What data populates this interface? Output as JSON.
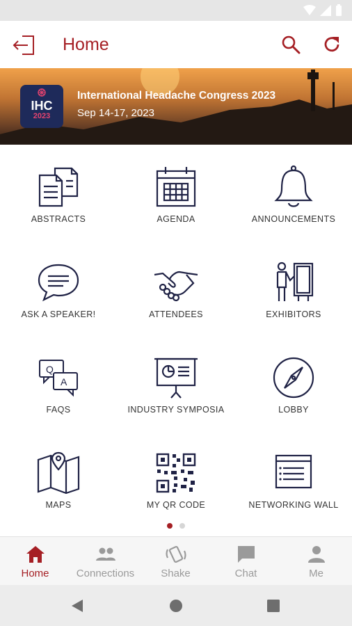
{
  "colors": {
    "accent": "#a51f24",
    "icon": "#1f2245",
    "inactive": "#9a9a9a"
  },
  "header": {
    "title": "Home"
  },
  "banner": {
    "logo_main": "IHC",
    "logo_year": "2023",
    "event_name": "International Headache Congress 2023",
    "dates": "Sep 14-17, 2023"
  },
  "tiles": [
    {
      "label": "ABSTRACTS",
      "icon": "documents-icon"
    },
    {
      "label": "AGENDA",
      "icon": "calendar-icon"
    },
    {
      "label": "ANNOUNCEMENTS",
      "icon": "bell-icon"
    },
    {
      "label": "ASK A SPEAKER!",
      "icon": "speech-bubble-icon"
    },
    {
      "label": "ATTENDEES",
      "icon": "handshake-icon"
    },
    {
      "label": "EXHIBITORS",
      "icon": "exhibitor-icon"
    },
    {
      "label": "FAQS",
      "icon": "qa-bubbles-icon"
    },
    {
      "label": "INDUSTRY SYMPOSIA",
      "icon": "presentation-board-icon"
    },
    {
      "label": "LOBBY",
      "icon": "compass-icon"
    },
    {
      "label": "MAPS",
      "icon": "map-icon"
    },
    {
      "label": "MY QR CODE",
      "icon": "qr-code-icon"
    },
    {
      "label": "NETWORKING WALL",
      "icon": "wall-post-icon"
    }
  ],
  "pager": {
    "pages": 2,
    "current": 1
  },
  "bottom_nav": [
    {
      "label": "Home",
      "icon": "home-icon",
      "active": true
    },
    {
      "label": "Connections",
      "icon": "people-icon",
      "active": false
    },
    {
      "label": "Shake",
      "icon": "shake-phone-icon",
      "active": false
    },
    {
      "label": "Chat",
      "icon": "chat-icon",
      "active": false
    },
    {
      "label": "Me",
      "icon": "person-icon",
      "active": false
    }
  ]
}
